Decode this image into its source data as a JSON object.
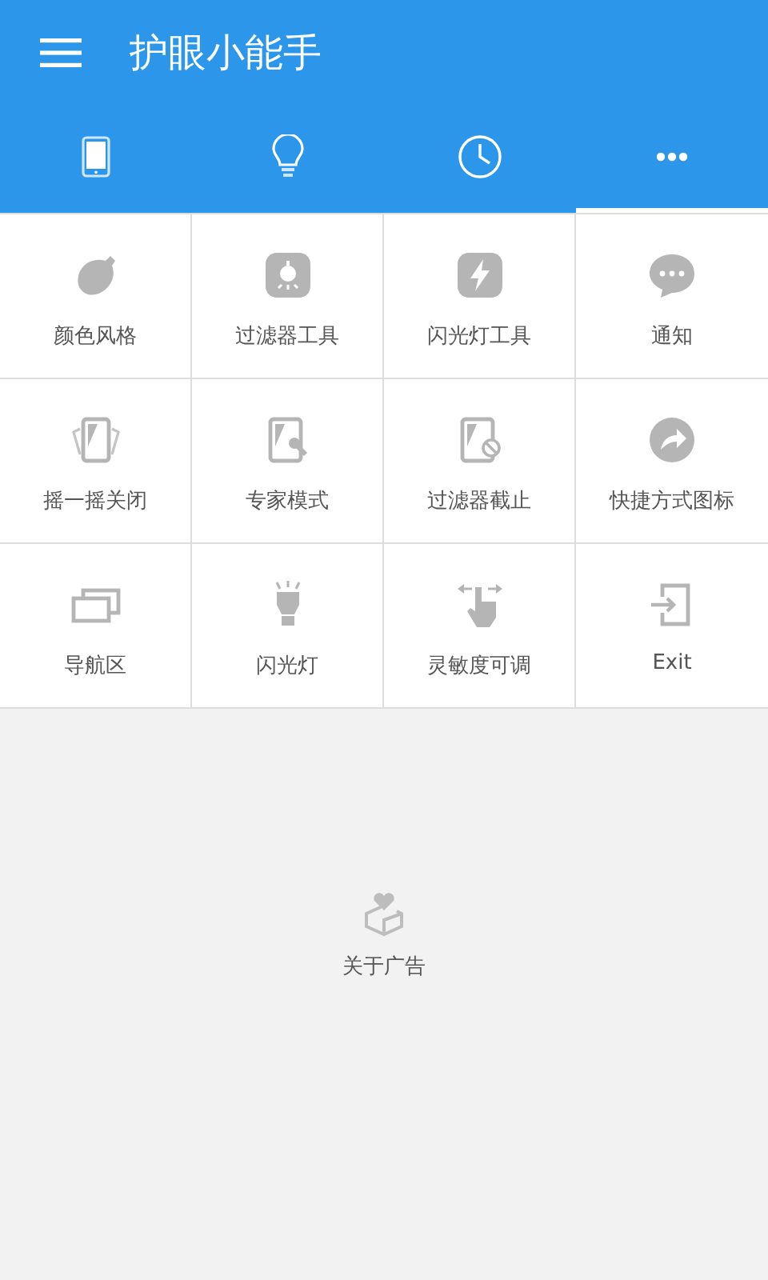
{
  "app_bar": {
    "title": "护眼小能手"
  },
  "tabs": [
    {
      "selected": false
    },
    {
      "selected": false
    },
    {
      "selected": false
    },
    {
      "selected": true
    }
  ],
  "grid": [
    {
      "label": "颜色风格"
    },
    {
      "label": "过滤器工具"
    },
    {
      "label": "闪光灯工具"
    },
    {
      "label": "通知"
    },
    {
      "label": "摇一摇关闭"
    },
    {
      "label": "专家模式"
    },
    {
      "label": "过滤器截止"
    },
    {
      "label": "快捷方式图标"
    },
    {
      "label": "导航区"
    },
    {
      "label": "闪光灯"
    },
    {
      "label": "灵敏度可调"
    },
    {
      "label": "Exit"
    }
  ],
  "ad": {
    "label": "关于广告"
  }
}
